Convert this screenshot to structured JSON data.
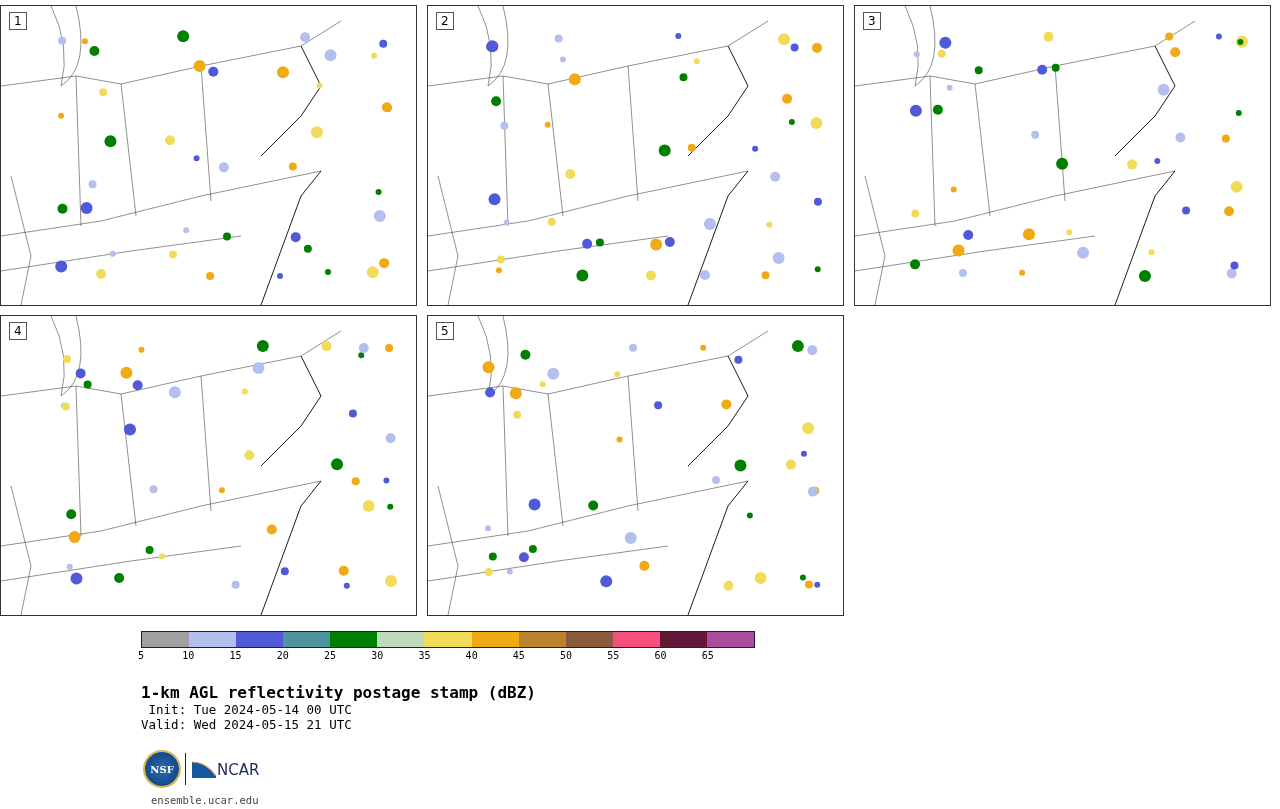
{
  "panels": [
    {
      "label": "1"
    },
    {
      "label": "2"
    },
    {
      "label": "3"
    },
    {
      "label": "4"
    },
    {
      "label": "5"
    }
  ],
  "colorbar": {
    "segments": [
      {
        "color": "#a0a0a0"
      },
      {
        "color": "#b4bff0"
      },
      {
        "color": "#505ad8"
      },
      {
        "color": "#4f969c"
      },
      {
        "color": "#008000"
      },
      {
        "color": "#bedcbc"
      },
      {
        "color": "#f0dc5a"
      },
      {
        "color": "#f0aa14"
      },
      {
        "color": "#bb8232"
      },
      {
        "color": "#8c5a3c"
      },
      {
        "color": "#f5507d"
      },
      {
        "color": "#5f1937"
      },
      {
        "color": "#aa4ba0"
      }
    ],
    "ticks": [
      "5",
      "10",
      "15",
      "20",
      "25",
      "30",
      "35",
      "40",
      "45",
      "50",
      "55",
      "60",
      "65"
    ]
  },
  "title": "1-km AGL reflectivity postage stamp (dBZ)",
  "init": " Init: Tue 2024-05-14 00 UTC",
  "valid": "Valid: Wed 2024-05-15 21 UTC",
  "logos": {
    "nsf": "NSF",
    "ncar": "NCAR"
  },
  "url": "ensemble.ucar.edu"
}
